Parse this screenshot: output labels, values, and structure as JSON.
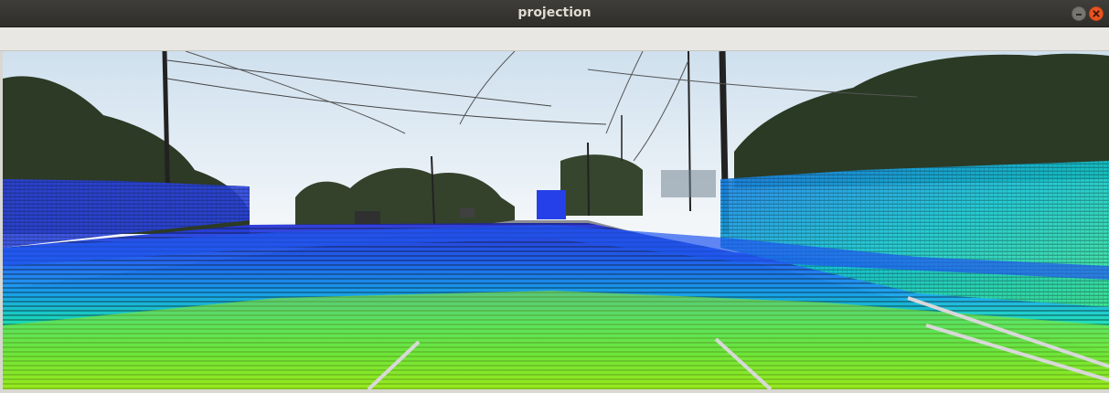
{
  "window": {
    "title": "projection"
  },
  "colors": {
    "titlebar": "#33322f",
    "title_text": "#dfdbd2",
    "close_button": "#e95420",
    "minimize_button": "#777570",
    "colormap_near": "#c8ff00",
    "colormap_mid": "#00ffa0",
    "colormap_far": "#0040ff"
  },
  "icons": {
    "minimize": "minimize-icon",
    "close": "close-icon"
  }
}
